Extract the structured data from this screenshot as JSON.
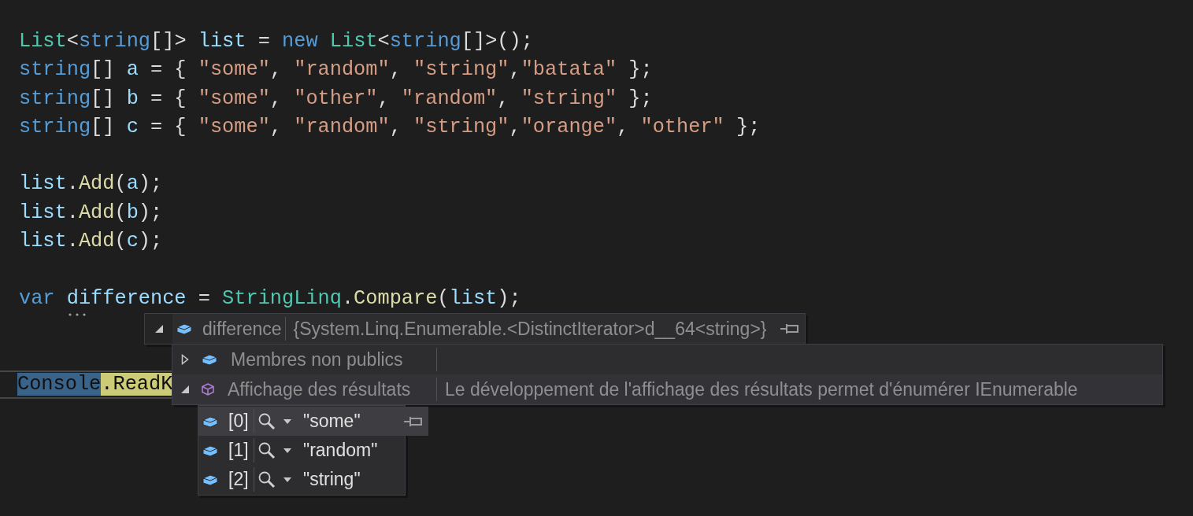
{
  "code_lines": [
    {
      "kind": "code",
      "tokens": [
        {
          "text": "List",
          "kind": "type"
        },
        {
          "text": "<",
          "kind": "plain"
        },
        {
          "text": "string",
          "kind": "keyword"
        },
        {
          "text": "[]> ",
          "kind": "plain"
        },
        {
          "text": "list",
          "kind": "local"
        },
        {
          "text": " = ",
          "kind": "plain"
        },
        {
          "text": "new ",
          "kind": "keyword"
        },
        {
          "text": "List",
          "kind": "type"
        },
        {
          "text": "<",
          "kind": "plain"
        },
        {
          "text": "string",
          "kind": "keyword"
        },
        {
          "text": "[]>();",
          "kind": "plain"
        }
      ]
    },
    {
      "kind": "code",
      "tokens": [
        {
          "text": "string",
          "kind": "keyword"
        },
        {
          "text": "[] ",
          "kind": "plain"
        },
        {
          "text": "a",
          "kind": "local"
        },
        {
          "text": " = { ",
          "kind": "plain"
        },
        {
          "text": "\"some\"",
          "kind": "string"
        },
        {
          "text": ", ",
          "kind": "plain"
        },
        {
          "text": "\"random\"",
          "kind": "string"
        },
        {
          "text": ", ",
          "kind": "plain"
        },
        {
          "text": "\"string\"",
          "kind": "string"
        },
        {
          "text": ",",
          "kind": "plain"
        },
        {
          "text": "\"batata\"",
          "kind": "string"
        },
        {
          "text": " };",
          "kind": "plain"
        }
      ]
    },
    {
      "kind": "code",
      "tokens": [
        {
          "text": "string",
          "kind": "keyword"
        },
        {
          "text": "[] ",
          "kind": "plain"
        },
        {
          "text": "b",
          "kind": "local"
        },
        {
          "text": " = { ",
          "kind": "plain"
        },
        {
          "text": "\"some\"",
          "kind": "string"
        },
        {
          "text": ", ",
          "kind": "plain"
        },
        {
          "text": "\"other\"",
          "kind": "string"
        },
        {
          "text": ", ",
          "kind": "plain"
        },
        {
          "text": "\"random\"",
          "kind": "string"
        },
        {
          "text": ", ",
          "kind": "plain"
        },
        {
          "text": "\"string\"",
          "kind": "string"
        },
        {
          "text": " };",
          "kind": "plain"
        }
      ]
    },
    {
      "kind": "code",
      "tokens": [
        {
          "text": "string",
          "kind": "keyword"
        },
        {
          "text": "[] ",
          "kind": "plain"
        },
        {
          "text": "c",
          "kind": "local"
        },
        {
          "text": " = { ",
          "kind": "plain"
        },
        {
          "text": "\"some\"",
          "kind": "string"
        },
        {
          "text": ", ",
          "kind": "plain"
        },
        {
          "text": "\"random\"",
          "kind": "string"
        },
        {
          "text": ", ",
          "kind": "plain"
        },
        {
          "text": "\"string\"",
          "kind": "string"
        },
        {
          "text": ",",
          "kind": "plain"
        },
        {
          "text": "\"orange\"",
          "kind": "string"
        },
        {
          "text": ", ",
          "kind": "plain"
        },
        {
          "text": "\"other\"",
          "kind": "string"
        },
        {
          "text": " };",
          "kind": "plain"
        }
      ]
    },
    {
      "kind": "blank"
    },
    {
      "kind": "code",
      "tokens": [
        {
          "text": "list",
          "kind": "local"
        },
        {
          "text": ".",
          "kind": "plain"
        },
        {
          "text": "Add",
          "kind": "method"
        },
        {
          "text": "(",
          "kind": "plain"
        },
        {
          "text": "a",
          "kind": "local"
        },
        {
          "text": ");",
          "kind": "plain"
        }
      ]
    },
    {
      "kind": "code",
      "tokens": [
        {
          "text": "list",
          "kind": "local"
        },
        {
          "text": ".",
          "kind": "plain"
        },
        {
          "text": "Add",
          "kind": "method"
        },
        {
          "text": "(",
          "kind": "plain"
        },
        {
          "text": "b",
          "kind": "local"
        },
        {
          "text": ");",
          "kind": "plain"
        }
      ]
    },
    {
      "kind": "code",
      "tokens": [
        {
          "text": "list",
          "kind": "local"
        },
        {
          "text": ".",
          "kind": "plain"
        },
        {
          "text": "Add",
          "kind": "method"
        },
        {
          "text": "(",
          "kind": "plain"
        },
        {
          "text": "c",
          "kind": "local"
        },
        {
          "text": ");",
          "kind": "plain"
        }
      ]
    },
    {
      "kind": "blank"
    },
    {
      "kind": "code",
      "tokens": [
        {
          "text": "var ",
          "kind": "keyword"
        },
        {
          "text": "difference",
          "kind": "local",
          "suggestion": true
        },
        {
          "text": " = ",
          "kind": "plain"
        },
        {
          "text": "StringLinq",
          "kind": "type"
        },
        {
          "text": ".",
          "kind": "plain"
        },
        {
          "text": "Compare",
          "kind": "method"
        },
        {
          "text": "(",
          "kind": "plain"
        },
        {
          "text": "list",
          "kind": "local"
        },
        {
          "text": ");",
          "kind": "plain"
        }
      ]
    },
    {
      "kind": "blank"
    },
    {
      "kind": "blank"
    },
    {
      "kind": "code",
      "current": true,
      "tokens": [
        {
          "text": "Console",
          "kind": "selection"
        },
        {
          "text": ".ReadK",
          "kind": "statement"
        }
      ]
    }
  ],
  "datatip": {
    "name": "difference",
    "value": "{System.Linq.Enumerable.<DistinctIterator>d__64<string>}",
    "expanded": true,
    "children": [
      {
        "kind": "object",
        "name": "Membres non publics",
        "expanded": false
      },
      {
        "kind": "results",
        "name": "Affichage des résultats",
        "value": "Le développement de l'affichage des résultats permet d'énumérer IEnumerable",
        "expanded": true
      }
    ],
    "results": [
      {
        "name": "[0]",
        "value": "\"some\"",
        "selected": true
      },
      {
        "name": "[1]",
        "value": "\"random\"",
        "selected": false
      },
      {
        "name": "[2]",
        "value": "\"string\"",
        "selected": false
      }
    ]
  }
}
